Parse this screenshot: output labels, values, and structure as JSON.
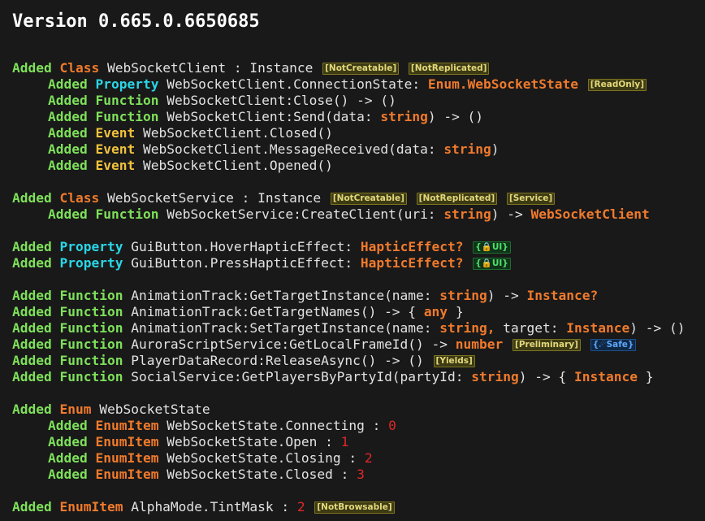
{
  "title": "Version 0.665.0.6650685",
  "lines": {
    "l1": {
      "added": "Added",
      "kw": "Class",
      "text": "WebSocketClient : Instance",
      "tag1": "[NotCreatable]",
      "tag2": "[NotReplicated]"
    },
    "l2": {
      "added": "Added",
      "kw": "Property",
      "text1": "WebSocketClient.ConnectionState:",
      "type": "Enum.WebSocketState",
      "tag1": "[ReadOnly]"
    },
    "l3": {
      "added": "Added",
      "kw": "Function",
      "text1": "WebSocketClient:Close() -> ()"
    },
    "l4": {
      "added": "Added",
      "kw": "Function",
      "text1": "WebSocketClient:Send(data:",
      "type": "string",
      "text2": ") -> ()"
    },
    "l5": {
      "added": "Added",
      "kw": "Event",
      "text1": "WebSocketClient.Closed()"
    },
    "l6": {
      "added": "Added",
      "kw": "Event",
      "text1": "WebSocketClient.MessageReceived(data:",
      "type": "string",
      "text2": ")"
    },
    "l7": {
      "added": "Added",
      "kw": "Event",
      "text1": "WebSocketClient.Opened()"
    },
    "l8": {
      "added": "Added",
      "kw": "Class",
      "text": "WebSocketService : Instance",
      "tag1": "[NotCreatable]",
      "tag2": "[NotReplicated]",
      "tag3": "[Service]"
    },
    "l9": {
      "added": "Added",
      "kw": "Function",
      "text1": "WebSocketService:CreateClient(uri:",
      "type": "string",
      "text2": ") ->",
      "type2": "WebSocketClient"
    },
    "l10": {
      "added": "Added",
      "kw": "Property",
      "text1": "GuiButton.HoverHapticEffect:",
      "type": "HapticEffect?",
      "tag1": "{🔒UI}"
    },
    "l11": {
      "added": "Added",
      "kw": "Property",
      "text1": "GuiButton.PressHapticEffect:",
      "type": "HapticEffect?",
      "tag1": "{🔒UI}"
    },
    "l12": {
      "added": "Added",
      "kw": "Function",
      "text1": "AnimationTrack:GetTargetInstance(name:",
      "type": "string",
      "text2": ") ->",
      "type2": "Instance?"
    },
    "l13": {
      "added": "Added",
      "kw": "Function",
      "text1": "AnimationTrack:GetTargetNames() -> {",
      "type": "any",
      "text2": "}"
    },
    "l14": {
      "added": "Added",
      "kw": "Function",
      "text1": "AnimationTrack:SetTargetInstance(name:",
      "type": "string,",
      "text2": "target:",
      "type2": "Instance",
      "text3": ") -> ()"
    },
    "l15": {
      "added": "Added",
      "kw": "Function",
      "text1": "AuroraScriptService:GetLocalFrameId() ->",
      "type": "number",
      "tag1": "[Preliminary]",
      "tag2": "{☄Safe}"
    },
    "l16": {
      "added": "Added",
      "kw": "Function",
      "text1": "PlayerDataRecord:ReleaseAsync() -> ()",
      "tag1": "[Yields]"
    },
    "l17": {
      "added": "Added",
      "kw": "Function",
      "text1": "SocialService:GetPlayersByPartyId(partyId:",
      "type": "string",
      "text2": ") -> {",
      "type2": "Instance",
      "text3": "}"
    },
    "l18": {
      "added": "Added",
      "kw": "Enum",
      "text1": "WebSocketState"
    },
    "l19": {
      "added": "Added",
      "kw": "EnumItem",
      "text1": "WebSocketState.Connecting :",
      "num": "0"
    },
    "l20": {
      "added": "Added",
      "kw": "EnumItem",
      "text1": "WebSocketState.Open :",
      "num": "1"
    },
    "l21": {
      "added": "Added",
      "kw": "EnumItem",
      "text1": "WebSocketState.Closing :",
      "num": "2"
    },
    "l22": {
      "added": "Added",
      "kw": "EnumItem",
      "text1": "WebSocketState.Closed :",
      "num": "3"
    },
    "l23": {
      "added": "Added",
      "kw": "EnumItem",
      "text1": "AlphaMode.TintMask :",
      "num": "2",
      "tag1": "[NotBrowsable]"
    }
  },
  "colors": {
    "background": "#191919",
    "added": "#7ee05a",
    "class": "#f07a2c",
    "property": "#2ad6e6",
    "event": "#f0c23c",
    "number": "#e02828"
  }
}
